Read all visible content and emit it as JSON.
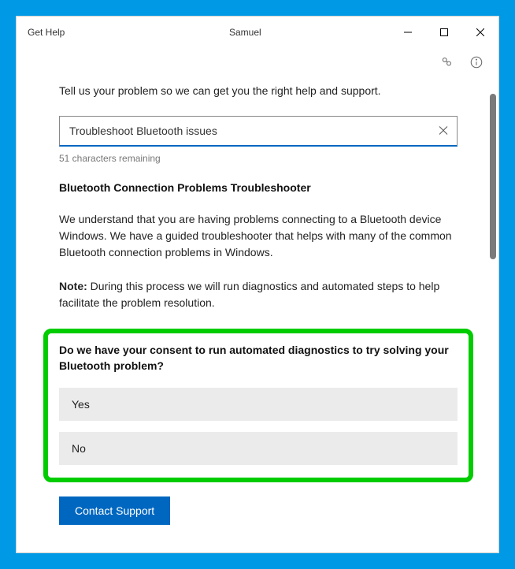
{
  "window": {
    "app_title": "Get Help",
    "user_name": "Samuel"
  },
  "intro": "Tell us your problem so we can get you the right help and support.",
  "search": {
    "value": "Troubleshoot Bluetooth issues",
    "char_remaining": "51 characters remaining"
  },
  "troubleshooter": {
    "title": "Bluetooth Connection Problems Troubleshooter",
    "body": "We understand that you are having problems connecting to a Bluetooth device Windows. We have a guided troubleshooter that helps with many of the common Bluetooth connection problems in Windows.",
    "note_label": "Note:",
    "note_body": " During this process we will run diagnostics and automated steps to help facilitate the problem resolution."
  },
  "consent": {
    "question": "Do we have your consent to run automated diagnostics to try solving your Bluetooth problem?",
    "options": {
      "yes": "Yes",
      "no": "No"
    }
  },
  "footer": {
    "contact_label": "Contact Support"
  }
}
